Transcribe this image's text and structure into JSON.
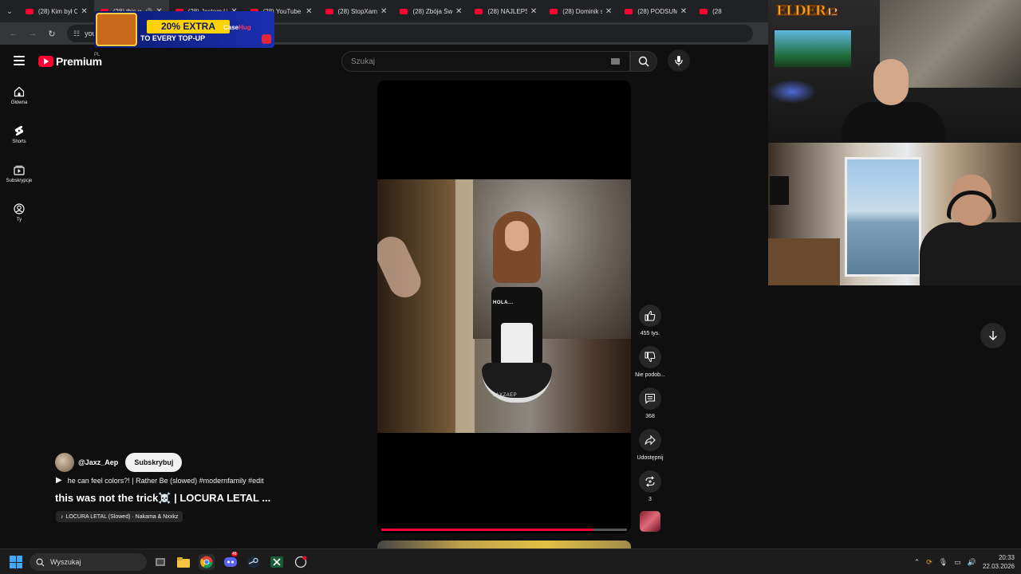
{
  "browser": {
    "tabs": [
      {
        "title": "(28) Kim był Cl",
        "active": false
      },
      {
        "title": "(28) this wa",
        "active": true
      },
      {
        "title": "(28) Jestem Uo",
        "active": false
      },
      {
        "title": "(28) YouTube",
        "active": false
      },
      {
        "title": "(28) StopXam I",
        "active": false
      },
      {
        "title": "(28) Zbója Świ",
        "active": false
      },
      {
        "title": "(28) NAJLEPSZ",
        "active": false
      },
      {
        "title": "(28) Dominik s",
        "active": false
      },
      {
        "title": "(28) PODSUMC",
        "active": false
      },
      {
        "title": "(28",
        "active": false
      }
    ],
    "url": "yout"
  },
  "ad": {
    "badge": "20% EXTRA",
    "sub": "TO EVERY TOP-UP",
    "brand_a": "Case",
    "brand_b": "Hug"
  },
  "header": {
    "logo_word": "Premium",
    "logo_country": "PL",
    "search_placeholder": "Szukaj"
  },
  "sidebar": {
    "items": [
      {
        "label": "Główna",
        "icon": "home-icon"
      },
      {
        "label": "Shorts",
        "icon": "shorts-icon"
      },
      {
        "label": "Subskrypcje",
        "icon": "subscriptions-icon"
      },
      {
        "label": "Ty",
        "icon": "profile-icon"
      }
    ]
  },
  "video": {
    "caption": "HOLA...",
    "watermark": "JAXZAEP",
    "progress": 0.86
  },
  "actions": {
    "likes": "455 tys.",
    "dislike": "Nie podob...",
    "comments": "368",
    "share": "Udostępnij",
    "remix": "3"
  },
  "channel": {
    "handle": "@Jaxz_Aep",
    "subscribe": "Subskrybuj",
    "description": "he can feel colors?! | Rather Be (slowed) #modernfamily #edit",
    "title": "this was not the trick☠️ | LOCURA LETAL ...",
    "music": "LOCURA LETAL (Slowed) · Nakama & Nxxkz"
  },
  "overlay": {
    "logo_text": "ELDER",
    "logo_num": "42"
  },
  "taskbar": {
    "search": "Wyszukaj",
    "time": "20:33",
    "date": "22.03.2026",
    "discord_badge": "48"
  },
  "colors": {
    "accent": "#ff0033",
    "background": "#0f0f0f"
  }
}
